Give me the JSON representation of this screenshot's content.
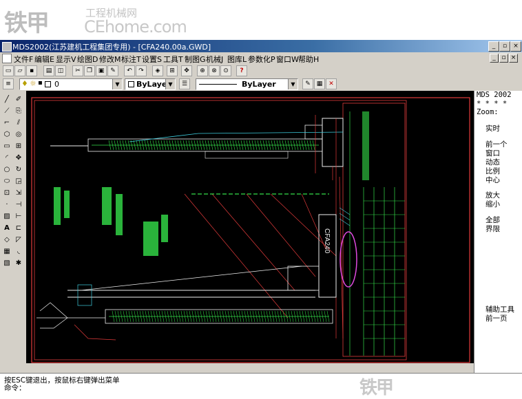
{
  "watermark": {
    "logo": "铁甲",
    "site_cn": "工程机械网",
    "site_en": "CEhome.com",
    "bottom": "铁甲"
  },
  "window": {
    "title": "MDS2002(江苏建机工程集团专用) - [CFA240.00a.GWD]",
    "controls": [
      "_",
      "▫",
      "×"
    ],
    "doc_controls": [
      "_",
      "▫",
      "×"
    ]
  },
  "menu": [
    "文件F",
    "编辑E",
    "显示V",
    "绘图D",
    "修改M",
    "标注T",
    "设置S",
    "工具T",
    "制图G",
    "机械J",
    "图库L",
    "参数化P",
    "窗口W",
    "帮助H"
  ],
  "layer": {
    "current": "0"
  },
  "color_combo": "ByLayer",
  "linetype_combo": "ByLayer",
  "drawing": {
    "top_label": "CFA240",
    "mast_labels": [
      "CFA240"
    ],
    "colors": {
      "red": "#e23b3b",
      "green": "#35e04a",
      "cyan": "#3ecfe0",
      "magenta": "#e04ae0",
      "white": "#f0f0f0",
      "frame": "#ff4040"
    }
  },
  "screen_menu": {
    "header1": "MDS 2002",
    "header2": "* * * *",
    "header3": "Zoom:",
    "items": [
      "实时",
      "前一个",
      "窗口",
      "动态",
      "比例",
      "中心",
      "放大",
      "缩小",
      "全部",
      "界限",
      "辅助工具",
      "前一页"
    ]
  },
  "command": {
    "line1": "按ESC键退出，按鼠标右键弹出菜单",
    "line2": "命令："
  }
}
